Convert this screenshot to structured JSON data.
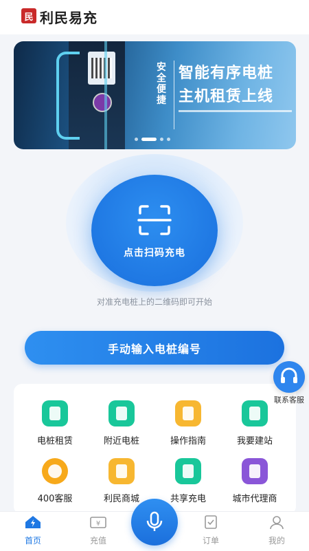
{
  "header": {
    "logo_char": "民",
    "title": "利民易充"
  },
  "banner": {
    "sub_text": "安全便捷",
    "line1": "智能有序电桩",
    "line2": "主机租赁上线",
    "pages": 4,
    "active_page": 1
  },
  "scan": {
    "label": "点击扫码充电",
    "hint": "对准充电桩上的二维码即可开始"
  },
  "manual": {
    "label": "手动输入电桩编号"
  },
  "service": {
    "label": "联系客服"
  },
  "grid": {
    "items": [
      {
        "label": "电桩租赁",
        "icon": "pile-icon",
        "color": "#19c79a"
      },
      {
        "label": "附近电桩",
        "icon": "pile-icon",
        "color": "#19c79a"
      },
      {
        "label": "操作指南",
        "icon": "guide-icon",
        "color": "#f7b731"
      },
      {
        "label": "我要建站",
        "icon": "pile-icon",
        "color": "#19c79a"
      },
      {
        "label": "400客服",
        "icon": "headset-icon",
        "color": "#f7a91b"
      },
      {
        "label": "利民商城",
        "icon": "mall-icon",
        "color": "#f7b731"
      },
      {
        "label": "共享充电",
        "icon": "pile-icon",
        "color": "#19c79a"
      },
      {
        "label": "城市代理商",
        "icon": "agent-icon",
        "color": "#8a56d8"
      }
    ]
  },
  "tabbar": {
    "items": [
      {
        "label": "首页",
        "icon": "home-icon",
        "active": true
      },
      {
        "label": "充值",
        "icon": "wallet-icon",
        "active": false
      },
      {
        "label": "订单",
        "icon": "order-icon",
        "active": false
      },
      {
        "label": "我的",
        "icon": "user-icon",
        "active": false
      }
    ],
    "mic_icon": "microphone-icon"
  },
  "colors": {
    "primary": "#1f78e3",
    "green": "#19c79a",
    "orange": "#f7b731",
    "purple": "#8a56d8"
  }
}
